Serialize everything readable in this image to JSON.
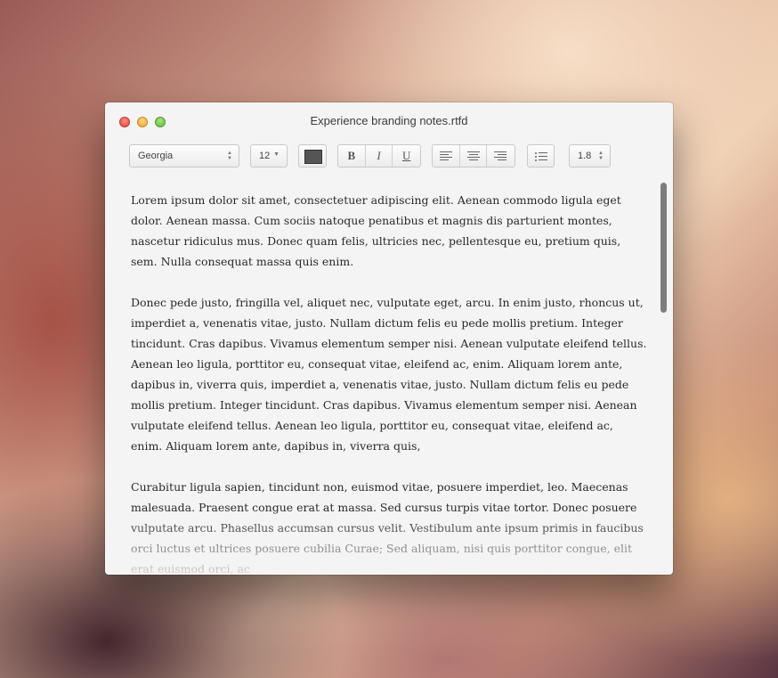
{
  "window": {
    "title": "Experience branding notes.rtfd"
  },
  "toolbar": {
    "font_family": "Georgia",
    "font_size": "12",
    "text_color": "#555555",
    "bold_label": "B",
    "italic_label": "I",
    "underline_label": "U",
    "line_spacing": "1.8",
    "icons": [
      "align-left-icon",
      "align-center-icon",
      "align-right-icon",
      "bulleted-list-icon",
      "stepper-icon",
      "dropdown-caret-icon"
    ]
  },
  "document": {
    "paragraphs": [
      "Lorem ipsum dolor sit amet, consectetuer adipiscing elit. Aenean commodo ligula eget dolor. Aenean massa. Cum sociis natoque penatibus et magnis dis parturient montes, nascetur ridiculus mus. Donec quam felis, ultricies nec, pellentesque eu, pretium quis, sem. Nulla consequat massa quis enim.",
      "Donec pede justo, fringilla vel, aliquet nec, vulputate eget, arcu. In enim justo, rhoncus ut, imperdiet a, venenatis vitae, justo. Nullam dictum felis eu pede mollis pretium. Integer tincidunt. Cras dapibus. Vivamus elementum semper nisi. Aenean vulputate eleifend tellus. Aenean leo ligula, porttitor eu, consequat vitae, eleifend ac, enim. Aliquam lorem ante, dapibus in, viverra quis, imperdiet a, venenatis vitae, justo. Nullam dictum felis eu pede mollis pretium. Integer tincidunt. Cras dapibus. Vivamus elementum semper nisi. Aenean vulputate eleifend tellus. Aenean leo ligula, porttitor eu, consequat vitae, eleifend ac, enim. Aliquam lorem ante, dapibus in, viverra quis,",
      "Curabitur ligula sapien, tincidunt non, euismod vitae, posuere imperdiet, leo. Maecenas malesuada. Praesent congue erat at massa. Sed cursus turpis vitae tortor. Donec posuere vulputate arcu. Phasellus accumsan cursus velit. Vestibulum ante ipsum primis in faucibus orci luctus et ultrices posuere cubilia Curae; Sed aliquam, nisi quis porttitor congue, elit erat euismod orci, ac"
    ]
  }
}
